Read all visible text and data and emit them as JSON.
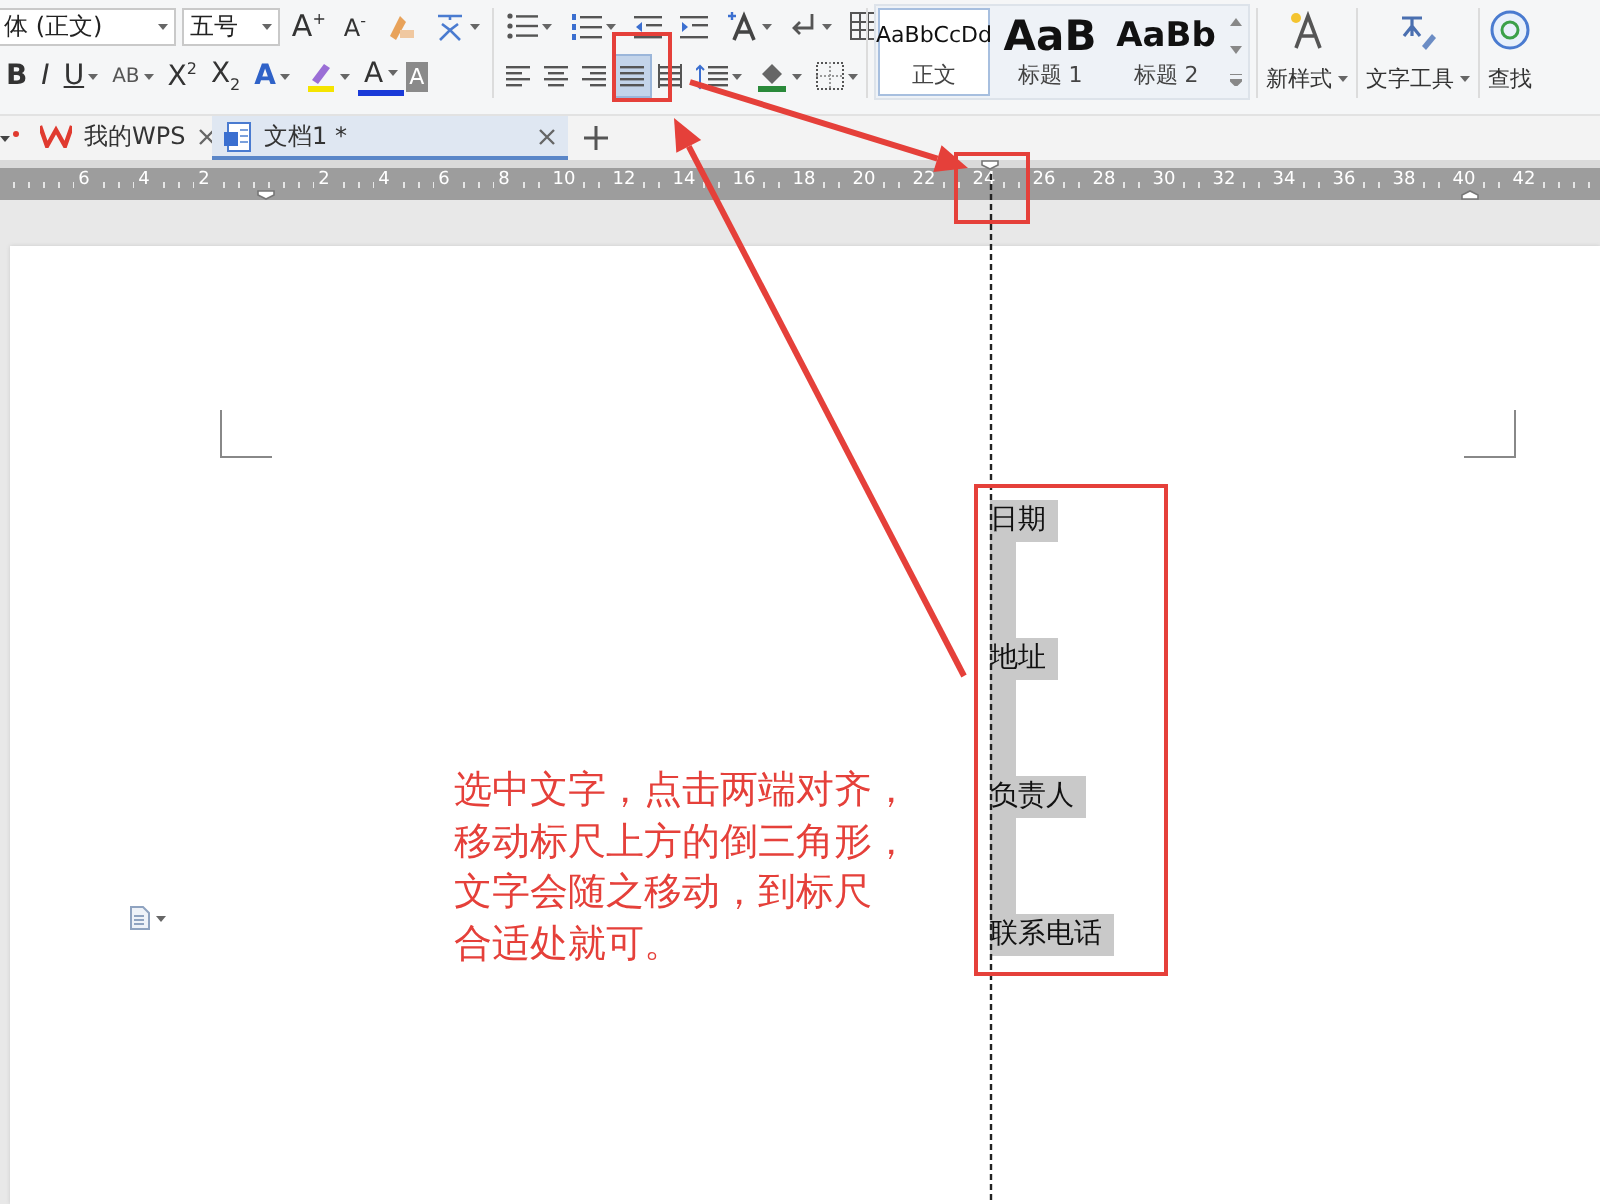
{
  "toolbar": {
    "font_name": "体 (正文)",
    "font_size": "五号",
    "font_buttons": [
      {
        "kind": "grow",
        "label": "A$^{+}$"
      },
      {
        "kind": "shrink",
        "label": "A$^{-}$"
      }
    ],
    "format_buttons": [
      {
        "kind": "bold",
        "label": "B"
      },
      {
        "kind": "italic",
        "label": "I"
      },
      {
        "kind": "underline",
        "label": "U"
      },
      {
        "kind": "strike",
        "label": "AB"
      },
      {
        "kind": "superscript",
        "label": "X$^{2}$"
      },
      {
        "kind": "subscript",
        "label": "X$_{2}$"
      },
      {
        "kind": "effect",
        "label": "A"
      },
      {
        "kind": "color",
        "label": "A"
      },
      {
        "kind": "shading",
        "label": "A"
      }
    ],
    "alignment_buttons": [
      {
        "kind": "left",
        "selected": false
      },
      {
        "kind": "center",
        "selected": false
      },
      {
        "kind": "right",
        "selected": false
      },
      {
        "kind": "justify",
        "selected": true
      },
      {
        "kind": "distributed",
        "selected": false
      }
    ],
    "styles": [
      {
        "kind": "body",
        "preview": "AaBbCcDd",
        "label": "正文",
        "selected": true
      },
      {
        "kind": "heading1",
        "preview": "AaB",
        "label": "标题 1",
        "selected": false
      },
      {
        "kind": "heading2",
        "preview": "AaBb",
        "label": "标题 2",
        "selected": false
      }
    ],
    "tool_buttons": [
      {
        "kind": "new_style",
        "label": "新样式"
      },
      {
        "kind": "text_tools",
        "label": "文字工具"
      },
      {
        "kind": "find",
        "label": "查找"
      }
    ]
  },
  "tabs": [
    {
      "kind": "home",
      "label": "我的WPS",
      "selected": false
    },
    {
      "kind": "document",
      "label": "文档1 *",
      "selected": true
    }
  ],
  "ruler": {
    "left_labels": [
      "6",
      "4",
      "2"
    ],
    "right_labels": [
      "2",
      "4",
      "6",
      "8",
      "10",
      "12",
      "14",
      "16",
      "18",
      "20",
      "22",
      "24",
      "26",
      "28",
      "30",
      "32",
      "34",
      "36",
      "38",
      "40",
      "42"
    ]
  },
  "document": {
    "lines": [
      {
        "text": "日期",
        "selected": true
      },
      {
        "text": "地址",
        "selected": true
      },
      {
        "text": "负责人",
        "selected": true
      },
      {
        "text": "联系电话",
        "selected": true
      }
    ]
  },
  "annotation": {
    "lines": [
      "选中文字，点击两端对齐，",
      "移动标尺上方的倒三角形，",
      "文字会随之移动，到标尺",
      "合适处就可。"
    ]
  }
}
